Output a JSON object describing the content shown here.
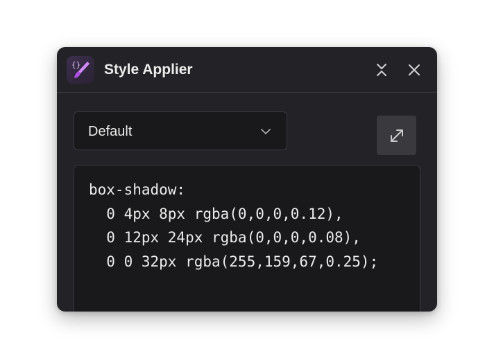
{
  "window": {
    "title": "Style Applier",
    "app_icon": "brush-code-icon",
    "collapse_icon": "collapse-icon",
    "close_icon": "close-icon"
  },
  "preset_select": {
    "value": "Default",
    "icon": "chevron-down-icon"
  },
  "expand_button": {
    "icon": "expand-icon"
  },
  "code": {
    "lines": [
      "box-shadow:",
      "  0 4px 8px rgba(0,0,0,0.12),",
      "  0 12px 24px rgba(0,0,0,0.08),",
      "  0 0 32px rgba(255,159,67,0.25);"
    ]
  },
  "colors": {
    "panel_bg": "#232226",
    "field_bg": "#19181b",
    "text": "#ececec",
    "icon_accent": "#c77dff"
  }
}
